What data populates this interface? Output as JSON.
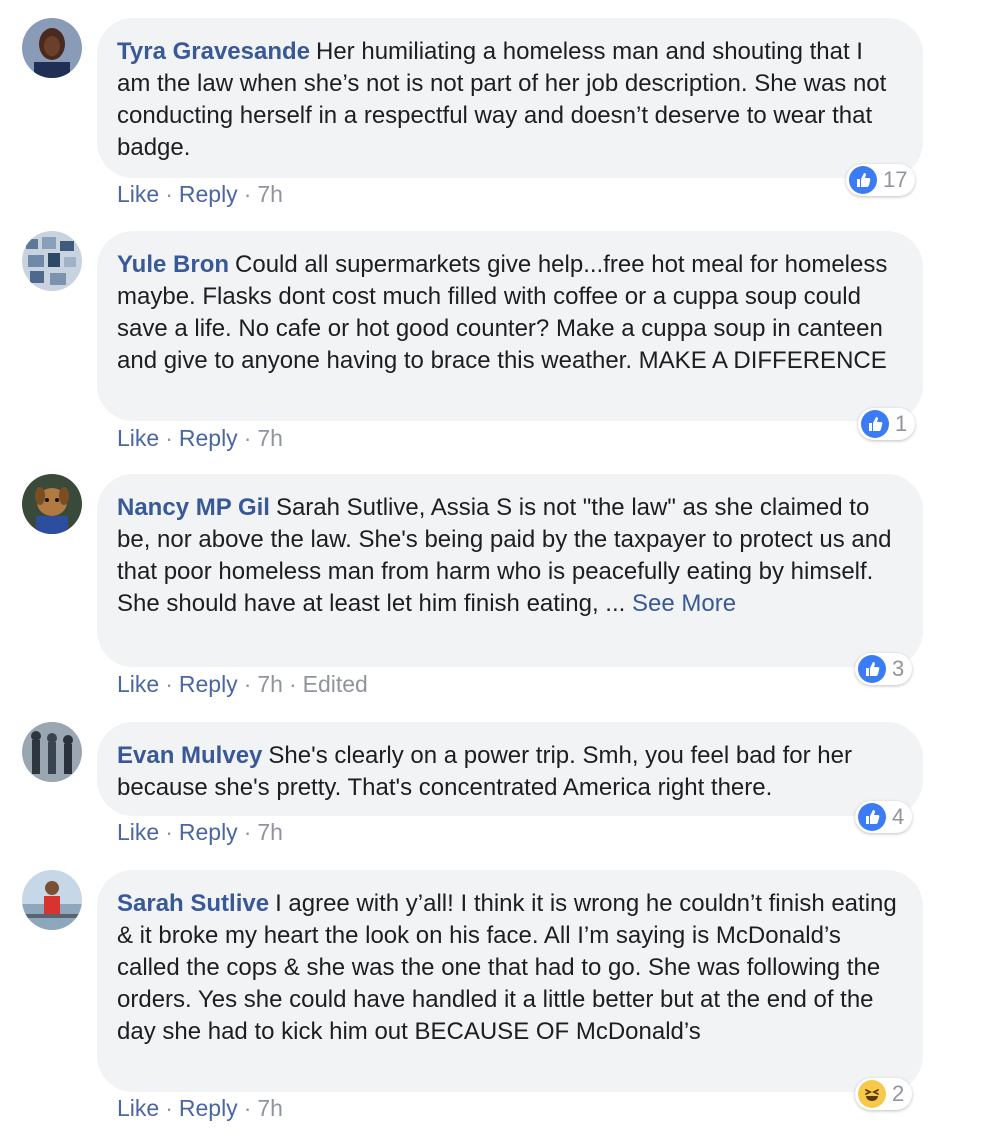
{
  "comments": [
    {
      "author": "Tyra Gravesande",
      "text": "Her humiliating a homeless man and shouting that I am the law when she’s not is not part of her job description. She was not conducting herself in a respectful way and doesn’t deserve to wear that badge.",
      "like": "Like",
      "reply": "Reply",
      "time": "7h",
      "reaction_icon": "thumbs-up-icon",
      "reaction_count": "17"
    },
    {
      "author": "Yule Bron",
      "text": "Could all supermarkets give help...free hot meal for homeless maybe. Flasks dont cost much filled with coffee or a cuppa soup could save a life. No cafe or hot good counter? Make a cuppa soup in canteen and give to anyone having to brace this weather. MAKE A DIFFERENCE",
      "like": "Like",
      "reply": "Reply",
      "time": "7h",
      "reaction_icon": "thumbs-up-icon",
      "reaction_count": "1"
    },
    {
      "author": "Nancy MP Gil",
      "text": "Sarah Sutlive, Assia S is not \"the law\" as she claimed to be, nor above the law. She's being paid by the taxpayer to protect us and that poor homeless man from harm who is peacefully eating by himself. She should have at least let him finish eating, ...",
      "see_more": "See More",
      "like": "Like",
      "reply": "Reply",
      "time": "7h",
      "edited": "Edited",
      "reaction_icon": "thumbs-up-icon",
      "reaction_count": "3"
    },
    {
      "author": "Evan Mulvey",
      "text": "She's clearly on a power trip. Smh, you feel bad for her because she's pretty. That's concentrated America right there.",
      "like": "Like",
      "reply": "Reply",
      "time": "7h",
      "reaction_icon": "thumbs-up-icon",
      "reaction_count": "4"
    },
    {
      "author": "Sarah Sutlive",
      "text": "I agree with y’all! I think it is wrong he couldn’t finish eating & it broke my heart the look on his face. All I’m saying is McDonald’s called the cops & she was the one that had to go. She was following the orders. Yes she could have handled it a little better but at the end of the day she had to kick him out BECAUSE OF McDonald’s",
      "like": "Like",
      "reply": "Reply",
      "time": "7h",
      "reaction_icon": "haha-icon",
      "reaction_count": "2"
    }
  ],
  "colors": {
    "link": "#385898",
    "bubble": "#f2f3f5",
    "meta": "#90949c",
    "like_blue": "#3b7cf5"
  }
}
